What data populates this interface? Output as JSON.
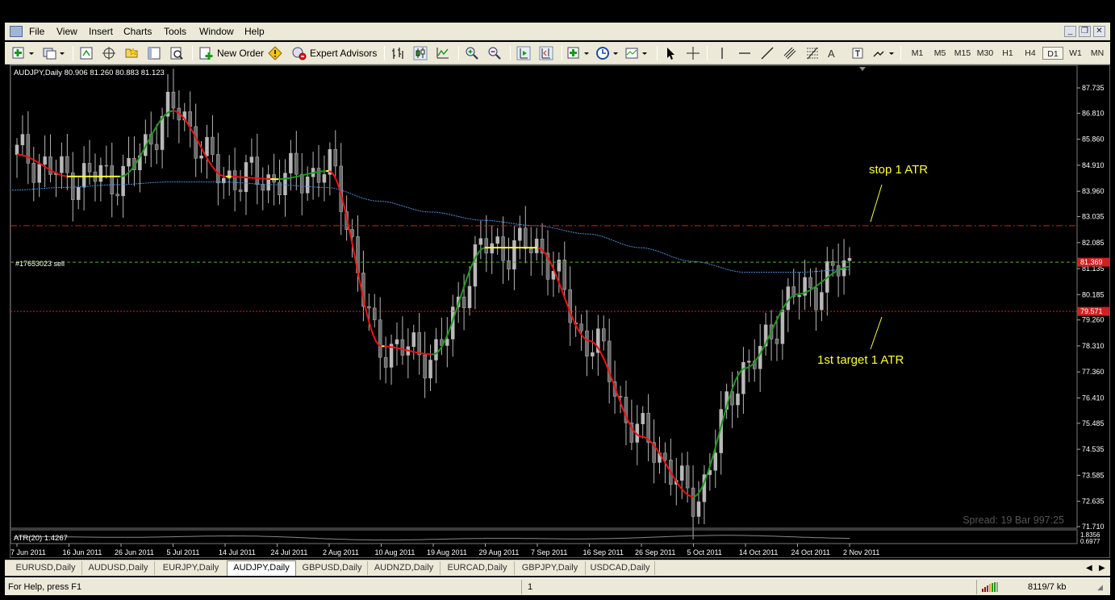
{
  "menu": [
    "File",
    "View",
    "Insert",
    "Charts",
    "Tools",
    "Window",
    "Help"
  ],
  "toolbar": {
    "new_order_label": "New Order",
    "expert_advisors_label": "Expert Advisors",
    "timeframes": [
      "M1",
      "M5",
      "M15",
      "M30",
      "H1",
      "H4",
      "D1",
      "W1",
      "MN"
    ],
    "active_timeframe": "D1"
  },
  "chart": {
    "header": "AUDJPY,Daily  80.906 81.260 80.883 81.123",
    "order_label": "#17653023 sell",
    "stop_annotation": "stop 1 ATR",
    "target_annotation": "1st target 1 ATR",
    "spread_text": "Spread: 19 Bar  997:25",
    "order_price_badge": "81.369",
    "target_price_badge": "79.571",
    "indicator_label": "ATR(20) 1.4267",
    "indicator_scale_top": "1.8356",
    "indicator_scale_bottom": "0.6977",
    "price_axis": [
      "87.735",
      "86.810",
      "85.860",
      "84.910",
      "83.960",
      "83.035",
      "82.085",
      "81.135",
      "80.185",
      "79.260",
      "78.310",
      "77.360",
      "76.410",
      "75.485",
      "74.535",
      "73.585",
      "72.635",
      "71.710"
    ],
    "date_axis": [
      "7 Jun 2011",
      "16 Jun 2011",
      "26 Jun 2011",
      "5 Jul 2011",
      "14 Jul 2011",
      "24 Jul 2011",
      "2 Aug 2011",
      "10 Aug 2011",
      "19 Aug 2011",
      "29 Aug 2011",
      "7 Sep 2011",
      "16 Sep 2011",
      "26 Sep 2011",
      "5 Oct 2011",
      "14 Oct 2011",
      "24 Oct 2011",
      "2 Nov 2011"
    ],
    "colors": {
      "background": "#000000",
      "candle": "#b8b8b8",
      "ma_up": "#1f9a1f",
      "ma_down": "#ee1111",
      "ma_flat": "#ffff33",
      "long_ma": "#4a8fd8",
      "stop_line": "#cc2222",
      "order_line": "#55aa33",
      "annotation": "#ffff33"
    }
  },
  "chart_data": {
    "type": "line",
    "title": "AUDJPY,Daily",
    "xlabel": "",
    "ylabel": "",
    "ylim": [
      71.71,
      87.735
    ],
    "x": [
      "7 Jun 2011",
      "16 Jun 2011",
      "26 Jun 2011",
      "5 Jul 2011",
      "14 Jul 2011",
      "24 Jul 2011",
      "2 Aug 2011",
      "10 Aug 2011",
      "19 Aug 2011",
      "29 Aug 2011",
      "7 Sep 2011",
      "16 Sep 2011",
      "26 Sep 2011",
      "5 Oct 2011",
      "14 Oct 2011",
      "24 Oct 2011",
      "2 Nov 2011"
    ],
    "series": [
      {
        "values": [
          85.3,
          84.5,
          84.5,
          86.9,
          84.5,
          84.4,
          84.7,
          78.3,
          78.0,
          81.9,
          81.9,
          78.5,
          75.0,
          72.8,
          77.5,
          80.2,
          81.2
        ]
      },
      {
        "values": [
          84.0,
          84.1,
          84.2,
          84.3,
          84.3,
          84.2,
          84.1,
          83.6,
          83.2,
          82.9,
          82.7,
          82.4,
          81.9,
          81.4,
          81.0,
          81.0,
          81.1
        ]
      }
    ],
    "horizontal_lines": [
      {
        "label": "stop 1 ATR",
        "y": 82.7
      },
      {
        "label": "#17653023 sell",
        "y": 81.369
      },
      {
        "label": "1st target 1 ATR",
        "y": 79.571
      }
    ]
  },
  "tabs": [
    "EURUSD,Daily",
    "AUDUSD,Daily",
    "EURJPY,Daily",
    "AUDJPY,Daily",
    "GBPUSD,Daily",
    "AUDNZD,Daily",
    "EURCAD,Daily",
    "GBPJPY,Daily",
    "USDCAD,Daily"
  ],
  "active_tab": "AUDJPY,Daily",
  "status": {
    "help": "For Help, press F1",
    "profile": "1",
    "traffic": "8119/7 kb"
  }
}
